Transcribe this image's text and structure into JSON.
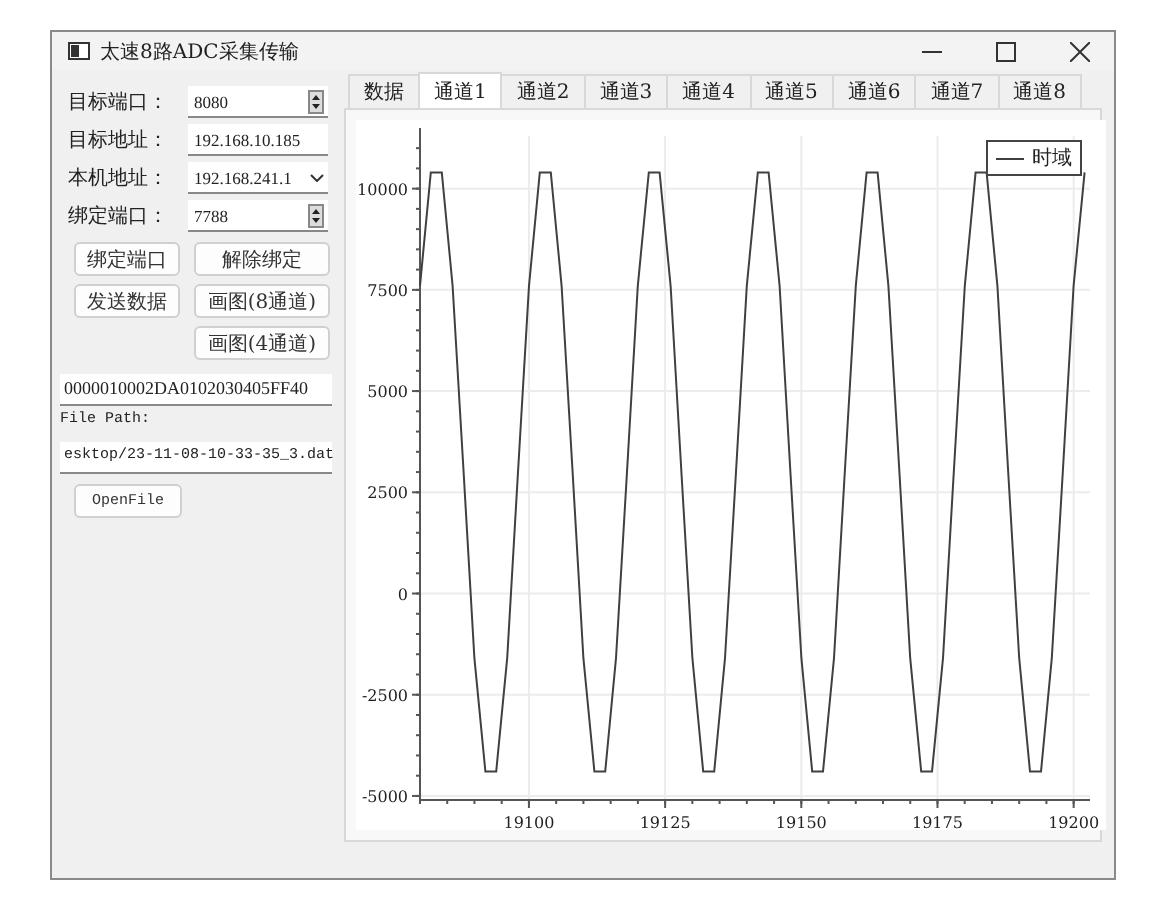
{
  "window": {
    "title": "太速8路ADC采集传输"
  },
  "form": {
    "fields": [
      {
        "label": "目标端口：",
        "value": "8080",
        "kind": "spin"
      },
      {
        "label": "目标地址：",
        "value": "192.168.10.185",
        "kind": "text"
      },
      {
        "label": "本机地址：",
        "value": "192.168.241.1",
        "kind": "combo"
      },
      {
        "label": "绑定端口：",
        "value": "7788",
        "kind": "spin"
      }
    ],
    "button_rows": [
      {
        "left": "绑定端口",
        "right": "解除绑定"
      },
      {
        "left": "发送数据",
        "right": "画图(8通道)"
      },
      {
        "right": "画图(4通道)"
      }
    ],
    "hex_field": {
      "value": "0000010002DA0102030405FF40"
    },
    "file_path_label": "File Path:",
    "file_path_field": {
      "value": "esktop/23-11-08-10-33-35_3.dat"
    },
    "open_button": "OpenFile"
  },
  "tabs": [
    {
      "label": "数据",
      "selected": false
    },
    {
      "label": "通道1",
      "selected": true
    },
    {
      "label": "通道2",
      "selected": false
    },
    {
      "label": "通道3",
      "selected": false
    },
    {
      "label": "通道4",
      "selected": false
    },
    {
      "label": "通道5",
      "selected": false
    },
    {
      "label": "通道6",
      "selected": false
    },
    {
      "label": "通道7",
      "selected": false
    },
    {
      "label": "通道8",
      "selected": false
    }
  ],
  "chart_data": {
    "type": "line",
    "grid": true,
    "xlim": [
      19080,
      19203
    ],
    "ylim": [
      -5100,
      11300
    ],
    "xticks": [
      19100,
      19125,
      19150,
      19175,
      19200
    ],
    "yticks": [
      -5000,
      -2500,
      0,
      2500,
      5000,
      7500,
      10000
    ],
    "x": [
      19080,
      19082,
      19084,
      19086,
      19088,
      19090,
      19092,
      19094,
      19096,
      19098,
      19100,
      19102,
      19104,
      19106,
      19108,
      19110,
      19112,
      19114,
      19116,
      19118,
      19120,
      19122,
      19124,
      19126,
      19128,
      19130,
      19132,
      19134,
      19136,
      19138,
      19140,
      19142,
      19144,
      19146,
      19148,
      19150,
      19152,
      19154,
      19156,
      19158,
      19160,
      19162,
      19164,
      19166,
      19168,
      19170,
      19172,
      19174,
      19176,
      19178,
      19180,
      19182,
      19184,
      19186,
      19188,
      19190,
      19192,
      19194,
      19196,
      19198,
      19200,
      19202
    ],
    "series": [
      {
        "name": "时域",
        "color": "#404040",
        "values": [
          7600,
          10400,
          10400,
          7600,
          3000,
          -1600,
          -4400,
          -4400,
          -1600,
          3000,
          7600,
          10400,
          10400,
          7600,
          3000,
          -1600,
          -4400,
          -4400,
          -1600,
          3000,
          7600,
          10400,
          10400,
          7600,
          3000,
          -1600,
          -4400,
          -4400,
          -1600,
          3000,
          7600,
          10400,
          10400,
          7600,
          3000,
          -1600,
          -4400,
          -4400,
          -1600,
          3000,
          7600,
          10400,
          10400,
          7600,
          3000,
          -1600,
          -4400,
          -4400,
          -1600,
          3000,
          7600,
          10400,
          10400,
          7600,
          3000,
          -1600,
          -4400,
          -4400,
          -1600,
          3000,
          7600,
          10400
        ]
      }
    ]
  }
}
